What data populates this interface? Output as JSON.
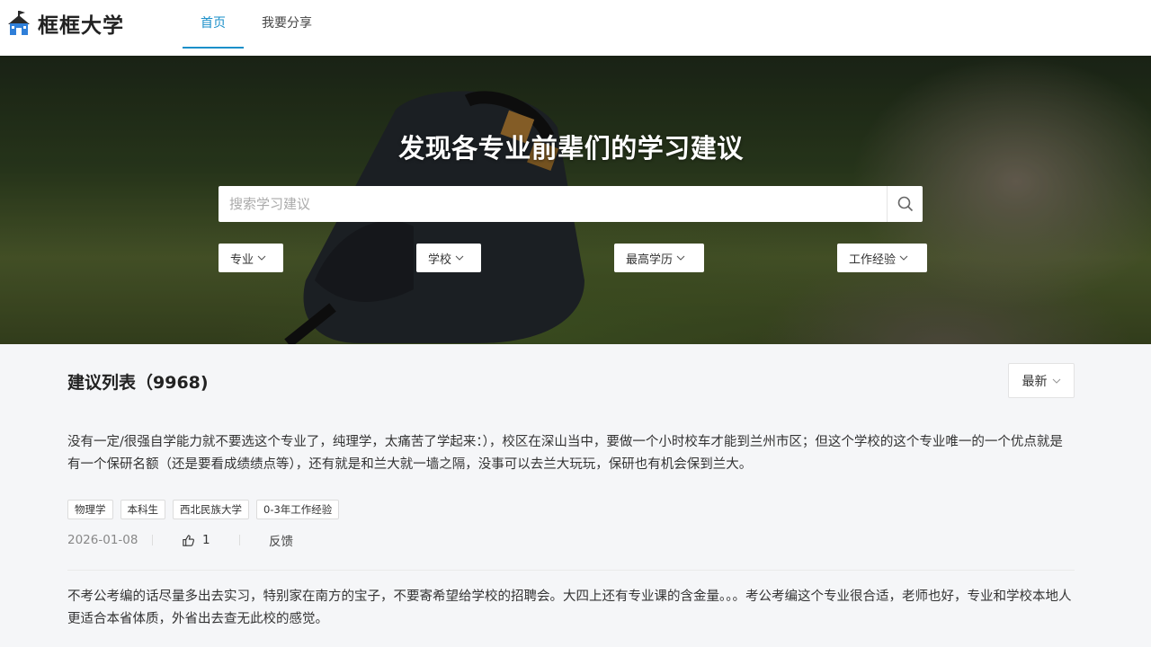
{
  "brand": {
    "name": "框框大学"
  },
  "nav": {
    "items": [
      {
        "label": "首页"
      },
      {
        "label": "我要分享"
      }
    ]
  },
  "hero": {
    "title": "发现各专业前辈们的学习建议",
    "search_placeholder": "搜索学习建议",
    "filters": [
      {
        "label": "专业"
      },
      {
        "label": "学校"
      },
      {
        "label": "最高学历"
      },
      {
        "label": "工作经验"
      }
    ]
  },
  "list": {
    "title": "建议列表（9968)",
    "sort_label": "最新",
    "items": [
      {
        "text": "没有一定/很强自学能力就不要选这个专业了，纯理学，太痛苦了学起来：），校区在深山当中，要做一个小时校车才能到兰州市区；但这个学校的这个专业唯一的一个优点就是有一个保研名额（还是要看成绩绩点等），还有就是和兰大就一墙之隔，没事可以去兰大玩玩，保研也有机会保到兰大。",
        "tags": [
          "物理学",
          "本科生",
          "西北民族大学",
          "0-3年工作经验"
        ],
        "date": "2026-01-08",
        "likes": "1",
        "feedback": "反馈"
      },
      {
        "text": "不考公考编的话尽量多出去实习，特别家在南方的宝子，不要寄希望给学校的招聘会。大四上还有专业课的含金量。。。考公考编这个专业很合适，老师也好，专业和学校本地人更适合本省体质，外省出去查无此校的感觉。"
      }
    ]
  },
  "icons": {
    "logo": "school-house-icon",
    "search": "search-icon",
    "chevron": "chevron-down-icon",
    "like": "thumbs-up-icon"
  },
  "colors": {
    "accent": "#1a8fc9"
  }
}
